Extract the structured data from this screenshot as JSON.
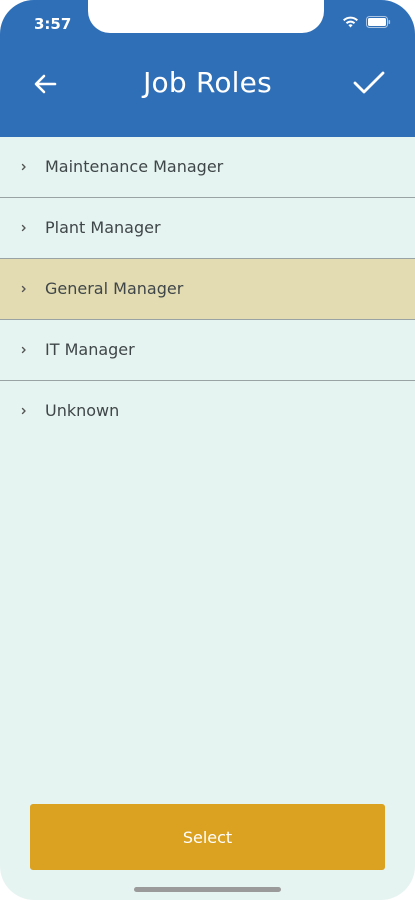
{
  "status_bar": {
    "time": "3:57"
  },
  "header": {
    "title": "Job Roles",
    "back_icon": "arrow-left-icon",
    "done_icon": "checkmark-icon"
  },
  "roles": [
    {
      "label": "Maintenance Manager",
      "selected": false
    },
    {
      "label": "Plant Manager",
      "selected": false
    },
    {
      "label": "General Manager",
      "selected": true
    },
    {
      "label": "IT Manager",
      "selected": false
    },
    {
      "label": "Unknown",
      "selected": false
    }
  ],
  "footer": {
    "select_label": "Select"
  },
  "colors": {
    "header": "#2f6fb8",
    "background": "#e6f4f1",
    "selected_row": "#e3dcb2",
    "button": "#dba121"
  }
}
